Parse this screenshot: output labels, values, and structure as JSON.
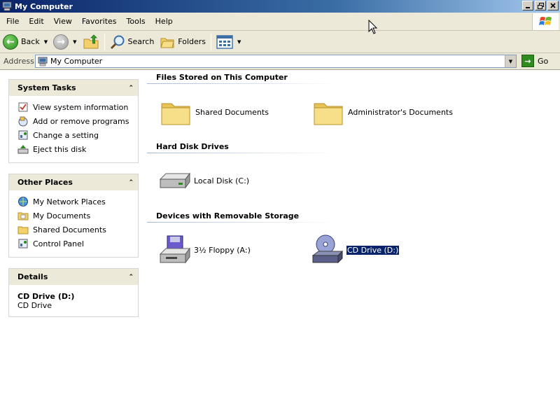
{
  "window": {
    "title": "My Computer",
    "controls": [
      "minimize-icon",
      "restore-icon",
      "close-icon"
    ]
  },
  "menu": [
    "File",
    "Edit",
    "View",
    "Favorites",
    "Tools",
    "Help"
  ],
  "toolbar": {
    "back": "Back",
    "search": "Search",
    "folders": "Folders"
  },
  "address": {
    "label": "Address",
    "value": "My Computer",
    "go": "Go"
  },
  "system_tasks": {
    "title": "System Tasks",
    "items": [
      "View system information",
      "Add or remove programs",
      "Change a setting",
      "Eject this disk"
    ]
  },
  "other_places": {
    "title": "Other Places",
    "items": [
      "My Network Places",
      "My Documents",
      "Shared Documents",
      "Control Panel"
    ]
  },
  "details": {
    "title": "Details",
    "name": "CD Drive (D:)",
    "type": "CD Drive"
  },
  "sections": {
    "files": {
      "title": "Files Stored on This Computer",
      "items": [
        "Shared Documents",
        "Administrator's Documents"
      ]
    },
    "hdd": {
      "title": "Hard Disk Drives",
      "items": [
        "Local Disk (C:)"
      ]
    },
    "removable": {
      "title": "Devices with Removable Storage",
      "items": [
        "3½ Floppy (A:)",
        "CD Drive (D:)"
      ]
    }
  },
  "colors": {
    "title_bar": "#0a246a",
    "panel_header": "#ece9d8",
    "selection": "#0a246a"
  }
}
